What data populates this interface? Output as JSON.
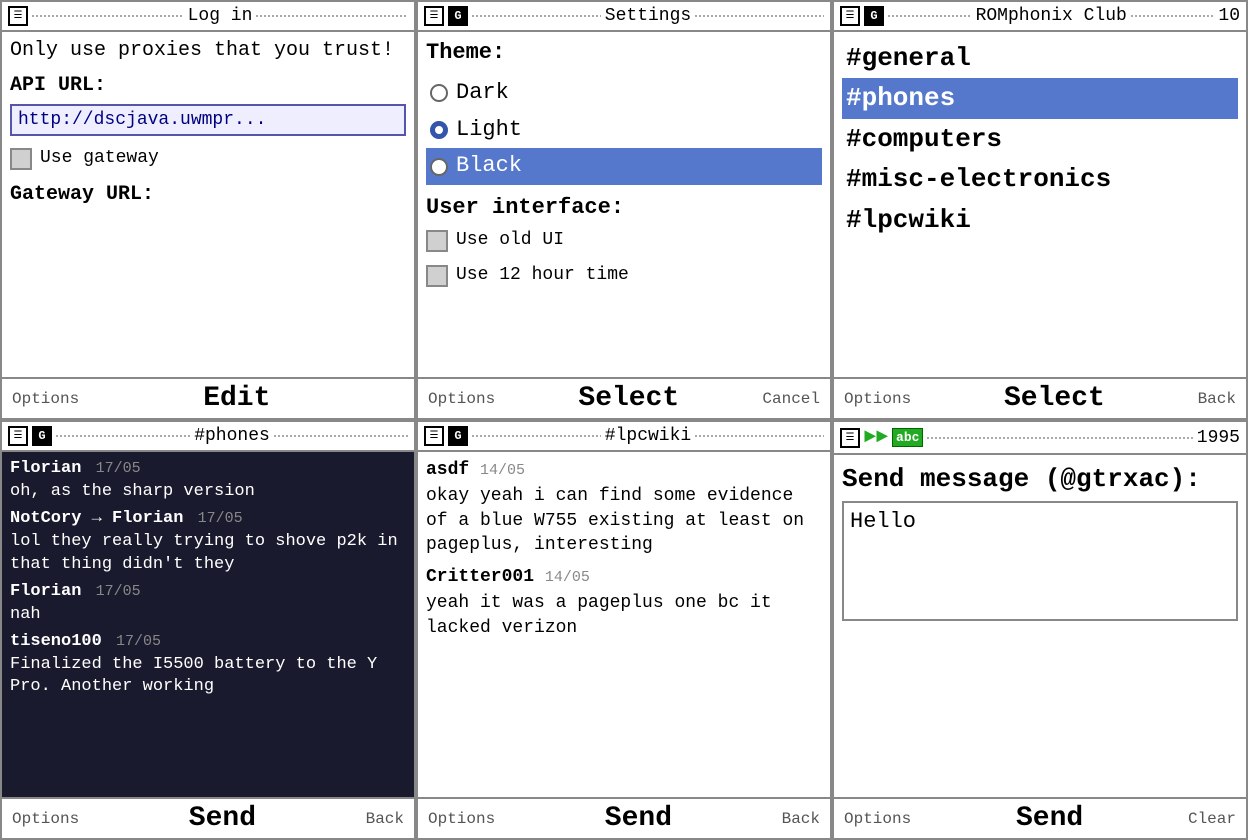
{
  "panel1": {
    "title": "Log in",
    "warning": "Only use proxies that you trust!",
    "api_label": "API URL:",
    "api_value": "http://dscjava.uwmpr...",
    "gateway_checkbox_label": "Use gateway",
    "gateway_label": "Gateway URL:",
    "footer_options": "Options",
    "footer_main": "Edit",
    "footer_right": ""
  },
  "panel2": {
    "title": "Settings",
    "theme_label": "Theme:",
    "themes": [
      {
        "label": "Dark",
        "selected": false
      },
      {
        "label": "Light",
        "selected": true
      },
      {
        "label": "Black",
        "selected": false,
        "highlighted": true
      }
    ],
    "ui_label": "User interface:",
    "ui_options": [
      {
        "label": "Use old UI"
      },
      {
        "label": "Use 12 hour time"
      }
    ],
    "footer_options": "Options",
    "footer_main": "Select",
    "footer_right": "Cancel"
  },
  "panel3": {
    "title": "ROMphonix Club",
    "count": "10",
    "channels": [
      {
        "name": "#general",
        "selected": false
      },
      {
        "name": "#phones",
        "selected": true
      },
      {
        "name": "#computers",
        "selected": false
      },
      {
        "name": "#misc-electronics",
        "selected": false
      },
      {
        "name": "#lpcwiki",
        "selected": false
      }
    ],
    "footer_options": "Options",
    "footer_main": "Select",
    "footer_right": "Back"
  },
  "panel4": {
    "title": "#phones",
    "messages": [
      {
        "user": "Florian",
        "date": "17/05",
        "text": "oh, as the sharp version"
      },
      {
        "user": "NotCory → Florian",
        "date": "17/05",
        "text": "lol they really trying to shove p2k in that thing didn't they"
      },
      {
        "user": "Florian",
        "date": "17/05",
        "text": "nah"
      },
      {
        "user": "tiseno100",
        "date": "17/05",
        "text": "Finalized the I5500 battery to the Y Pro. Another working"
      }
    ],
    "footer_options": "Options",
    "footer_main": "Send",
    "footer_right": "Back"
  },
  "panel5": {
    "title": "#lpcwiki",
    "messages": [
      {
        "user": "asdf",
        "date": "14/05",
        "text": "okay yeah i can find some evidence of a blue W755 existing at least on pageplus, interesting"
      },
      {
        "user": "Critter001",
        "date": "14/05",
        "text": "yeah it was a pageplus one bc it lacked verizon"
      }
    ],
    "footer_options": "Options",
    "footer_main": "Send",
    "footer_right": "Back"
  },
  "panel6": {
    "count": "1995",
    "send_title": "Send message (@gtrxac):",
    "message_value": "Hello",
    "footer_options": "Options",
    "footer_main": "Send",
    "footer_right": "Clear"
  }
}
